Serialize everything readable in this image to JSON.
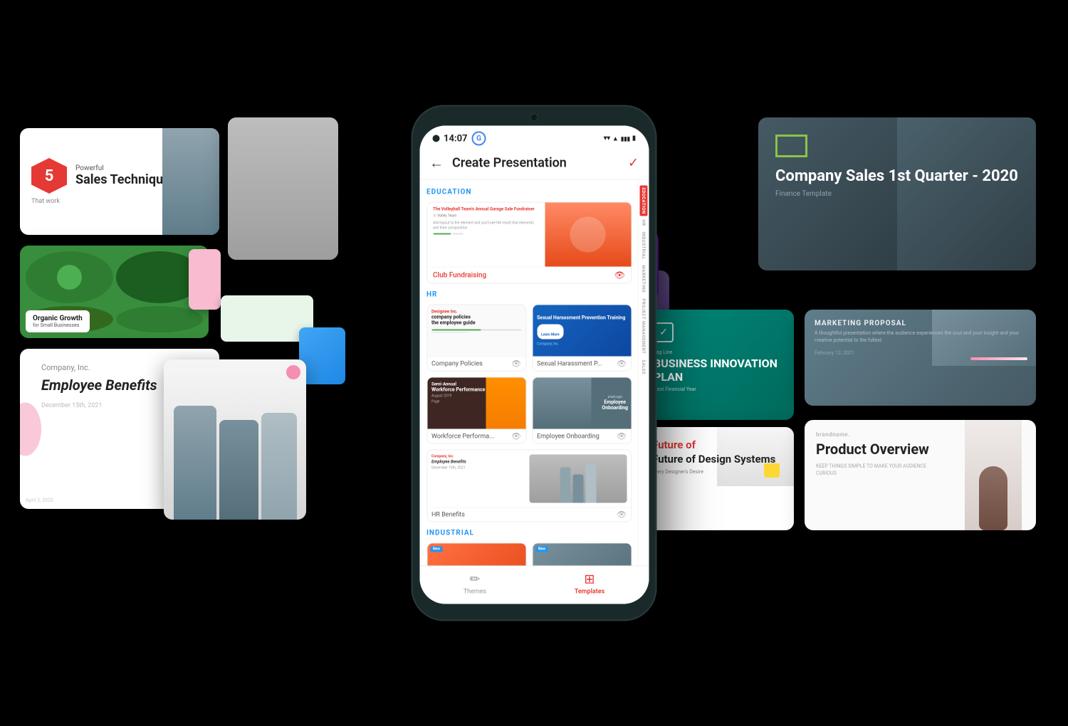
{
  "app": {
    "title": "Create Presentation",
    "status_time": "14:07",
    "google_logo": "G"
  },
  "nav": {
    "back": "←",
    "check": "✓"
  },
  "sections": [
    {
      "id": "education",
      "label": "EDUCATION",
      "index_label": "EDUCATION",
      "active": true
    },
    {
      "id": "hr",
      "label": "HR",
      "index_label": "HR"
    },
    {
      "id": "industrial",
      "label": "INDUSTRIAL",
      "index_label": "INDUSTRIAL"
    },
    {
      "id": "marketing",
      "label": "MARKETING",
      "index_label": "MARKETING"
    },
    {
      "id": "project_management",
      "label": "PROJECT MANAGEMENT",
      "index_label": "PROJECT MANAGEMENT"
    },
    {
      "id": "sales",
      "label": "SALES",
      "index_label": "SALES"
    }
  ],
  "templates": {
    "education": [
      {
        "name": "Club Fundraising",
        "featured": true
      }
    ],
    "hr": [
      {
        "name": "Company Policies"
      },
      {
        "name": "Sexual Harassment P..."
      },
      {
        "name": "Workforce Performa..."
      },
      {
        "name": "Employee Onboarding"
      },
      {
        "name": "HR Benefits"
      }
    ]
  },
  "bottom_nav": [
    {
      "label": "Themes",
      "icon": "✏",
      "active": false
    },
    {
      "label": "Templates",
      "icon": "▦",
      "active": true
    }
  ],
  "bg_cards": {
    "sales_techniques": {
      "number": "5",
      "title": "Sales Techniques",
      "subtitle": "Powerful",
      "caption": "That work"
    },
    "organic_growth": {
      "title": "Organic Growth",
      "subtitle": "for Small Businesses"
    },
    "employee_benefits": {
      "company": "Company, Inc.",
      "title": "Employee Benefits",
      "date": "December 15th, 2021"
    },
    "company_sales": {
      "title": "Company Sales 1st Quarter - 2020",
      "subtitle": "Finance Template"
    },
    "biz_innovation": {
      "title": "BUSINESS INNOVATION PLAN",
      "subtitle": "Next Financial Year"
    },
    "design_systems": {
      "title": "Future of Design Systems",
      "subtitle": "Every Designer's Desire"
    },
    "product_overview": {
      "title": "Product Overview",
      "subtitle": "KEEP THINGS SIMPLE TO MAKE YOUR AUDIENCE CURIOUS"
    },
    "marketing_proposal": {
      "title": "MARKETING PROPOSAL"
    }
  }
}
